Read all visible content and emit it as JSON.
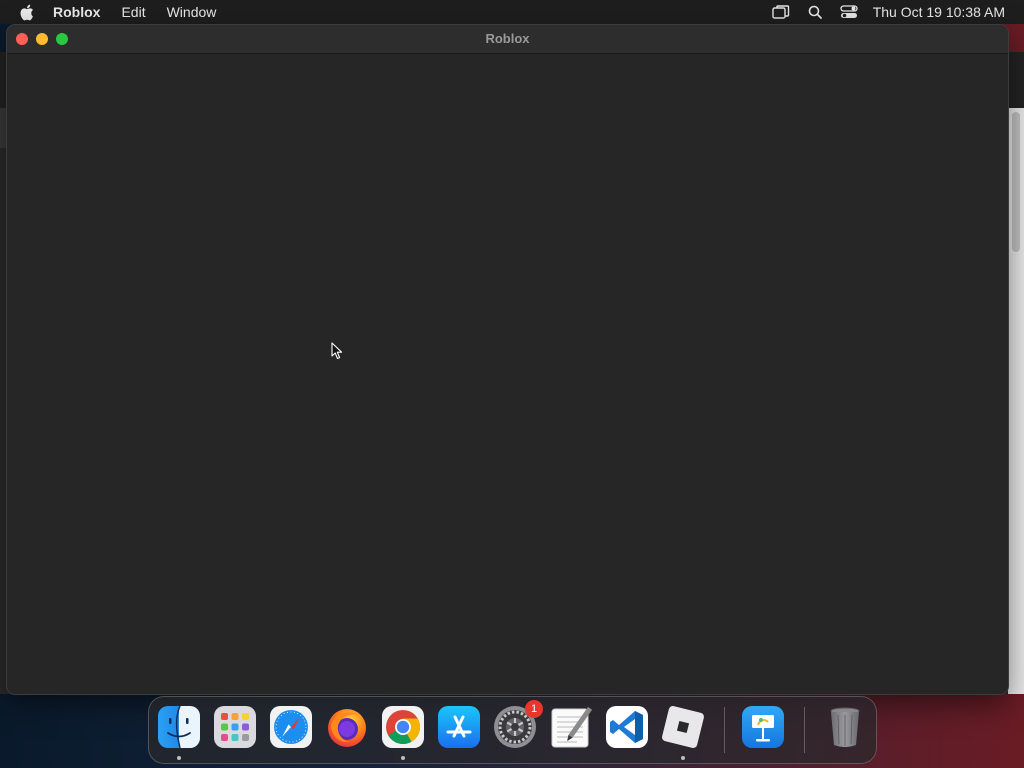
{
  "menubar": {
    "app_name": "Roblox",
    "menus": [
      "Edit",
      "Window"
    ],
    "status_icons": [
      "window-manager-icon",
      "search-icon",
      "control-center-icon"
    ],
    "clock": "Thu Oct 19  10:38 AM"
  },
  "window": {
    "title": "Roblox"
  },
  "dock": {
    "items": [
      {
        "name": "Finder",
        "icon": "finder-icon",
        "running": true
      },
      {
        "name": "Launchpad",
        "icon": "launchpad-icon",
        "running": false
      },
      {
        "name": "Safari",
        "icon": "safari-icon",
        "running": false
      },
      {
        "name": "Firefox",
        "icon": "firefox-icon",
        "running": false
      },
      {
        "name": "Google Chrome",
        "icon": "chrome-icon",
        "running": true
      },
      {
        "name": "App Store",
        "icon": "app-store-icon",
        "running": false
      },
      {
        "name": "System Settings",
        "icon": "settings-icon",
        "running": false,
        "badge": "1"
      },
      {
        "name": "TextEdit",
        "icon": "textedit-icon",
        "running": false
      },
      {
        "name": "Visual Studio Code",
        "icon": "vscode-icon",
        "running": false
      },
      {
        "name": "Roblox",
        "icon": "roblox-icon",
        "running": true
      },
      {
        "name": "Keynote",
        "icon": "keynote-icon",
        "running": false
      },
      {
        "name": "Trash",
        "icon": "trash-icon",
        "running": false
      }
    ]
  },
  "colors": {
    "close": "#fe5f57",
    "minimize": "#febc2e",
    "maximize": "#28c840",
    "badge": "#e8352e"
  }
}
